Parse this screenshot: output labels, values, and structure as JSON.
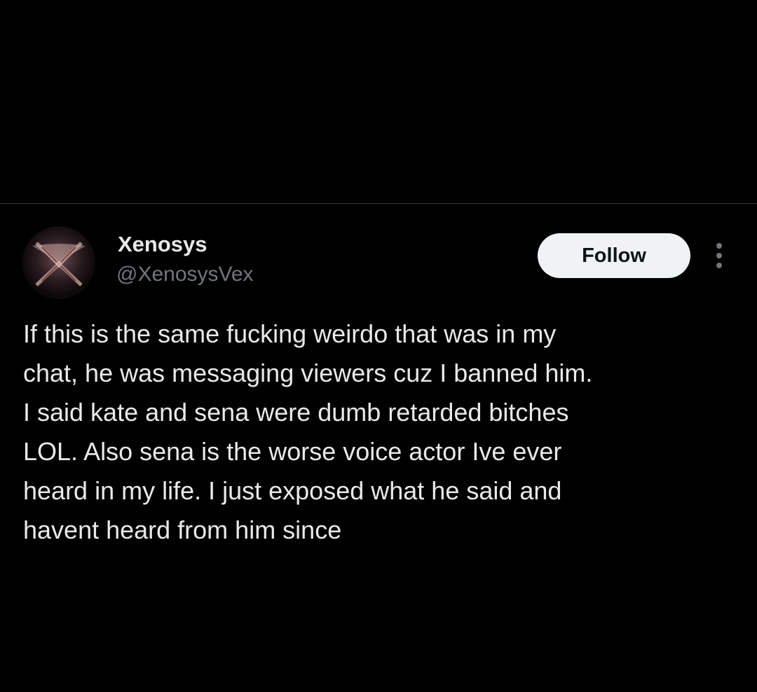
{
  "tweet": {
    "author": {
      "display_name": "Xenosys",
      "handle": "@XenosysVex"
    },
    "follow_label": "Follow",
    "more_icon": "more-vertical-icon",
    "text": "If this is the same fucking weirdo that was in my\nchat, he was messaging viewers cuz I banned him.\nI said kate and sena were dumb retarded bitches\nLOL. Also sena is the worse voice actor Ive ever\nheard in my life. I just exposed what he said and\nhavent heard from him since"
  },
  "colors": {
    "background": "#000000",
    "divider": "#2f3336",
    "primary_text": "#e7e9ea",
    "secondary_text": "#71767b",
    "follow_button_bg": "#eff3f4",
    "follow_button_text": "#0f1419"
  }
}
